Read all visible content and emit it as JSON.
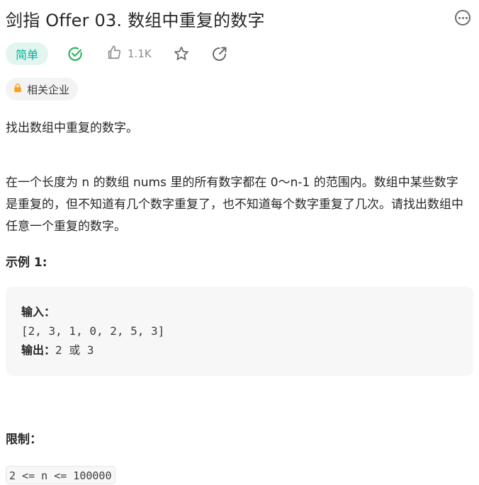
{
  "problem": {
    "title": "剑指 Offer 03. 数组中重复的数字",
    "difficulty": "简单",
    "likes": "1.1K",
    "company_tag": "相关企业",
    "icons": [
      "more-icon",
      "solved-check-icon",
      "thumbs-up-icon",
      "star-icon",
      "share-icon",
      "lock-icon"
    ]
  },
  "description": {
    "line1": "找出数组中重复的数字。",
    "line2": "在一个长度为 n 的数组 nums 里的所有数字都在 0～n-1 的范围内。数组中某些数字是重复的，但不知道有几个数字重复了，也不知道每个数字重复了几次。请找出数组中任意一个重复的数字。"
  },
  "example": {
    "title": "示例 1:",
    "input_label": "输入：",
    "input_value": "[2, 3, 1, 0, 2, 5, 3]",
    "output_label": "输出：",
    "output_value": "2 或 3"
  },
  "constraints": {
    "title": "限制：",
    "value": "2 <= n <= 100000"
  },
  "colors": {
    "easy_text": "#00af9b",
    "easy_bg": "#e2f5ef",
    "solved_green": "#2db55d",
    "lock_orange": "#ffa116",
    "icon_gray": "#6b6b6b"
  }
}
